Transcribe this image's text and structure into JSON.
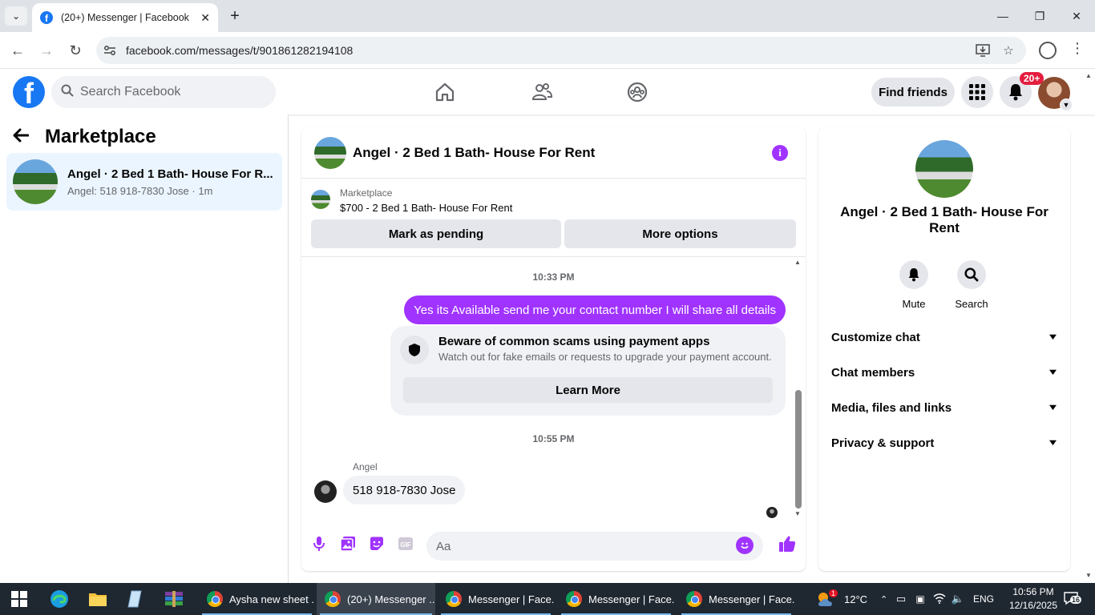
{
  "browser": {
    "tab_title": "(20+) Messenger | Facebook",
    "url": "facebook.com/messages/t/901861282194108"
  },
  "fb": {
    "search_placeholder": "Search Facebook",
    "find_friends": "Find friends",
    "notif_count": "20+"
  },
  "left": {
    "title": "Marketplace",
    "conversation": {
      "title": "Angel · 2 Bed 1 Bath- House For R...",
      "subtitle": "Angel: 518 918-7830 Jose · 1m"
    }
  },
  "chat": {
    "header_title": "Angel · 2 Bed 1 Bath- House For Rent",
    "marketplace_label": "Marketplace",
    "listing": "$700 - 2 Bed 1 Bath- House For Rent",
    "mark_pending": "Mark as pending",
    "more_options": "More options",
    "time1": "10:33 PM",
    "outgoing_message": "Yes its Available send me your contact number I will share all details",
    "warning_title": "Beware of common scams using payment apps",
    "warning_text": "Watch out for fake emails or requests to upgrade your payment account.",
    "learn_more": "Learn More",
    "time2": "10:55 PM",
    "sender": "Angel",
    "incoming_message": "518 918-7830 Jose",
    "composer_placeholder": "Aa"
  },
  "right": {
    "name": "Angel · 2 Bed 1 Bath- House For Rent",
    "mute": "Mute",
    "search": "Search",
    "sections": [
      "Customize chat",
      "Chat members",
      "Media, files and links",
      "Privacy & support"
    ]
  },
  "taskbar": {
    "apps": [
      "Aysha new sheet ...",
      "(20+) Messenger ...",
      "Messenger | Face...",
      "Messenger | Face...",
      "Messenger | Face..."
    ],
    "weather": "12°C",
    "weather_badge": "1",
    "lang": "ENG",
    "time": "10:56 PM",
    "date": "12/16/2025",
    "notif_count": "16"
  },
  "colors": {
    "accent": "#a033ff",
    "fb_blue": "#1877f2",
    "selected_bg": "#ebf5ff"
  }
}
